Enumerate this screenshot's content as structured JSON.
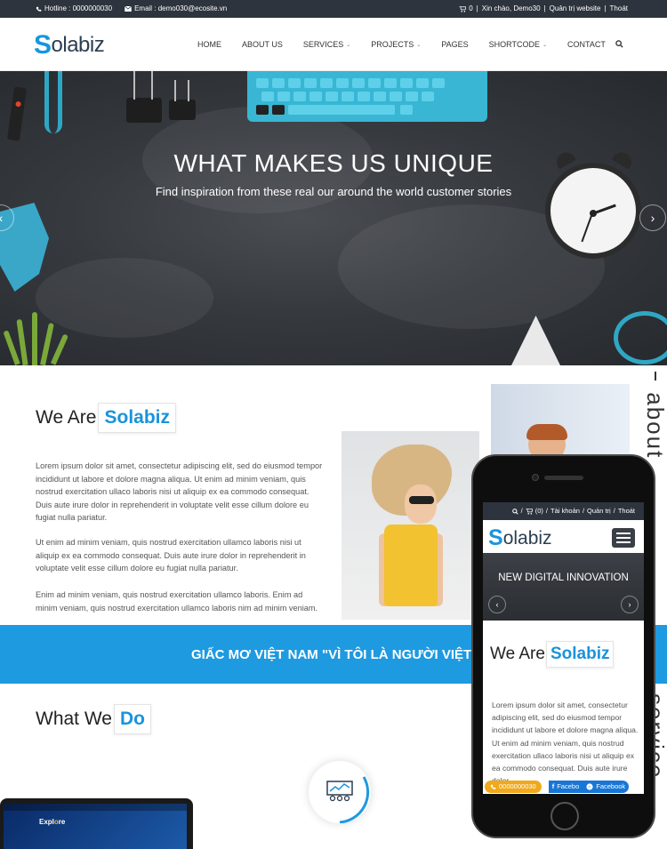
{
  "topbar": {
    "hotline": "Hotline : 0000000030",
    "email": "Email : demo030@ecosite.vn",
    "cart_count": "0",
    "greeting": "Xin chào, Demo30",
    "admin": "Quản trị website",
    "logout": "Thoát"
  },
  "header": {
    "logo_s": "S",
    "logo_rest": "olabiz",
    "nav": [
      {
        "label": "Home"
      },
      {
        "label": "About us"
      },
      {
        "label": "Services"
      },
      {
        "label": "Projects"
      },
      {
        "label": "Pages"
      },
      {
        "label": "Shortcode"
      },
      {
        "label": "Contact"
      }
    ]
  },
  "hero": {
    "title": "WHAT MAKES US UNIQUE",
    "subtitle": "Find inspiration from these real our around the world customer stories"
  },
  "about": {
    "title_plain": "We Are",
    "title_highlight": "Solabiz",
    "vertical_label": "about",
    "paragraphs": [
      "Lorem ipsum dolor sit amet, consectetur adipiscing elit, sed do eiusmod tempor incididunt ut labore et dolore magna aliqua. Ut enim ad minim veniam, quis nostrud exercitation ullaco laboris nisi ut aliquip ex ea commodo consequat. Duis aute irure dolor in reprehenderit in voluptate velit esse cillum dolore eu fugiat nulla pariatur.",
      "Ut enim ad minim veniam, quis nostrud exercitation ullamco laboris nisi ut aliquip ex ea commodo consequat. Duis aute irure dolor in reprehenderit in voluptate velit esse cillum dolore eu fugiat nulla pariatur.",
      "Enim ad minim veniam, quis nostrud exercitation ullamco laboris. Enim ad minim veniam, quis nostrud exercitation ullamco laboris nim ad minim veniam."
    ]
  },
  "banner": {
    "text": "GIẤC MƠ VIỆT NAM \"VÌ TÔI LÀ NGƯỜI VIỆT\""
  },
  "services": {
    "title_plain": "What We",
    "title_highlight": "Do",
    "vertical_label": "service"
  },
  "laptop": {
    "explore_pre": "Expl",
    "explore_o": "o",
    "explore_post": "re"
  },
  "phone": {
    "top_cart": "(0)",
    "top_account": "Tài khoản",
    "top_admin": "Quản trị",
    "top_logout": "Thoát",
    "logo_s": "S",
    "logo_rest": "olabiz",
    "hero_title": "NEW DIGITAL INNOVATION",
    "title_plain": "We Are",
    "title_highlight": "Solabiz",
    "paragraph": "Lorem ipsum dolor sit amet, consectetur adipiscing elit, sed do eiusmod tempor incididunt ut labore et dolore magna aliqua. Ut enim ad minim veniam, quis nostrud exercitation ullaco laboris nisi ut aliquip ex ea commodo consequat. Duis aute irure dolor",
    "call": "0000000030",
    "fb1": "Facebo",
    "fb2": "Facebook"
  },
  "colors": {
    "accent": "#1e9ae0",
    "topbar": "#2e343d",
    "call": "#f0a91b",
    "facebook": "#1877d6"
  }
}
